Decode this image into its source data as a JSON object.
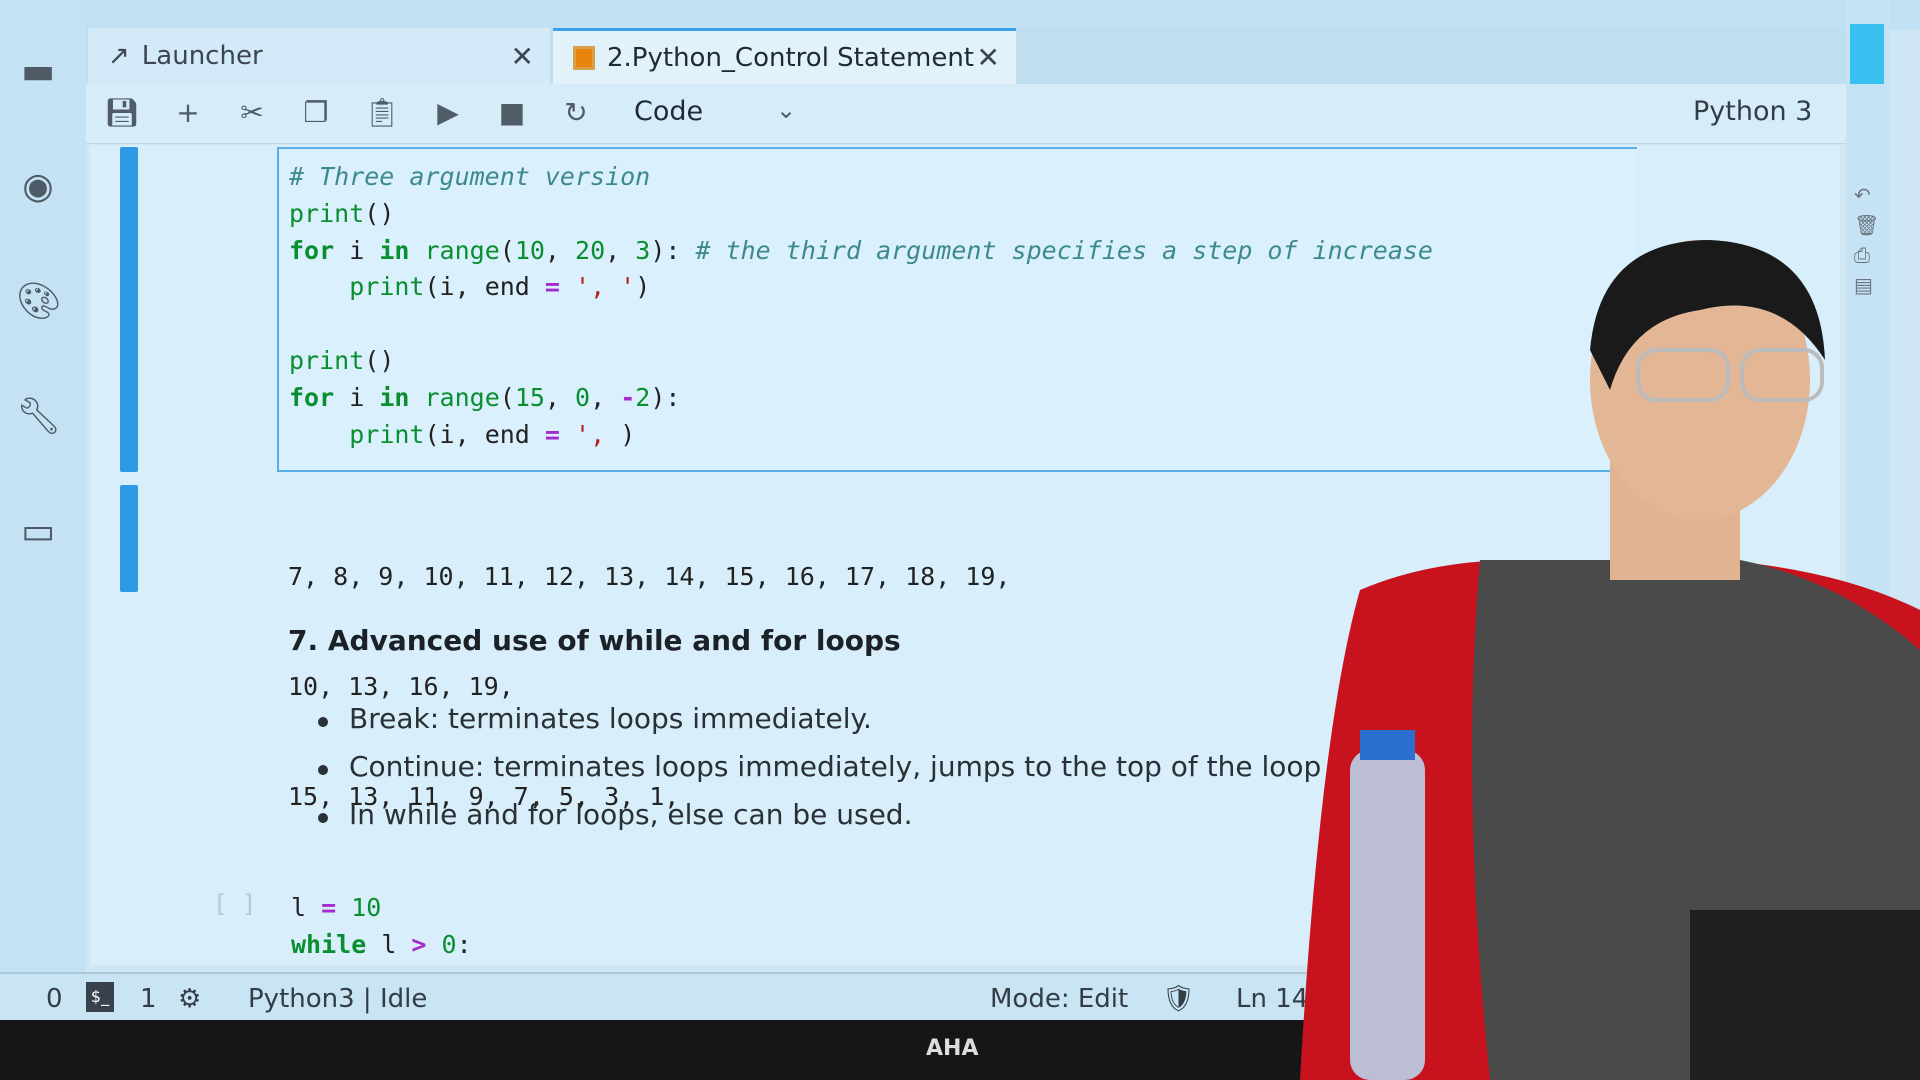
{
  "tabs": [
    {
      "label": "Launcher",
      "icon": "launcher-icon"
    },
    {
      "label": "2.Python_Control Statement",
      "icon": "notebook-icon",
      "active": true
    }
  ],
  "toolbar": {
    "cell_type": "Code",
    "kernel": "Python 3"
  },
  "code_cell": {
    "lines": [
      [
        [
          "# Three argument version",
          "cm"
        ]
      ],
      [
        [
          "print",
          "bi"
        ],
        [
          "()",
          "p"
        ]
      ],
      [
        [
          "for",
          "kw"
        ],
        [
          " i ",
          "p"
        ],
        [
          "in",
          "kw"
        ],
        [
          " ",
          "p"
        ],
        [
          "range",
          "bi"
        ],
        [
          "(",
          "p"
        ],
        [
          "10",
          "n"
        ],
        [
          ", ",
          "p"
        ],
        [
          "20",
          "n"
        ],
        [
          ", ",
          "p"
        ],
        [
          "3",
          "n"
        ],
        [
          "): ",
          "p"
        ],
        [
          "# the third argument specifies a step of increase",
          "cm"
        ]
      ],
      [
        [
          "    ",
          "p"
        ],
        [
          "print",
          "bi"
        ],
        [
          "(i, end ",
          "p"
        ],
        [
          "=",
          "op"
        ],
        [
          " ",
          "p"
        ],
        [
          "', '",
          "st"
        ],
        [
          ")",
          "p"
        ]
      ],
      [],
      [
        [
          "print",
          "bi"
        ],
        [
          "()",
          "p"
        ]
      ],
      [
        [
          "for",
          "kw"
        ],
        [
          " i ",
          "p"
        ],
        [
          "in",
          "kw"
        ],
        [
          " ",
          "p"
        ],
        [
          "range",
          "bi"
        ],
        [
          "(",
          "p"
        ],
        [
          "15",
          "n"
        ],
        [
          ", ",
          "p"
        ],
        [
          "0",
          "n"
        ],
        [
          ", ",
          "p"
        ],
        [
          "-",
          "op"
        ],
        [
          "2",
          "n"
        ],
        [
          "):",
          "p"
        ]
      ],
      [
        [
          "    ",
          "p"
        ],
        [
          "print",
          "bi"
        ],
        [
          "(i, end ",
          "p"
        ],
        [
          "=",
          "op"
        ],
        [
          " ",
          "p"
        ],
        [
          "', ",
          "st"
        ],
        [
          ")",
          "p"
        ]
      ]
    ]
  },
  "output": [
    "7, 8, 9, 10, 11, 12, 13, 14, 15, 16, 17, 18, 19,",
    "10, 13, 16, 19,",
    "15, 13, 11, 9, 7, 5, 3, 1,"
  ],
  "markdown": {
    "heading": "7. Advanced use of while and for loops",
    "bullets": [
      "Break: terminates loops immediately.",
      "Continue: terminates loops immediately, jumps to the top of the loop and cont",
      "In while and for loops, else can be used."
    ]
  },
  "next_cell": {
    "prompt": "[ ]",
    "lines": [
      [
        [
          "l ",
          "p"
        ],
        [
          "=",
          "op"
        ],
        [
          " ",
          "p"
        ],
        [
          "10",
          "n"
        ]
      ],
      [
        [
          "while",
          "kw"
        ],
        [
          " l ",
          "p"
        ],
        [
          ">",
          "op"
        ],
        [
          " ",
          "p"
        ],
        [
          "0",
          "n"
        ],
        [
          ":",
          "p"
        ]
      ]
    ]
  },
  "status": {
    "terminals": "0",
    "kernels": "1",
    "kernel_status": "Python3 | Idle",
    "mode": "Mode: Edit",
    "position": "Ln 14, C"
  },
  "bezel_logo": "AHA",
  "colors": {
    "accent": "#2d9ae3",
    "keyword": "#0a8f30",
    "comment": "#3d8a8c",
    "operator": "#a52ad0"
  }
}
